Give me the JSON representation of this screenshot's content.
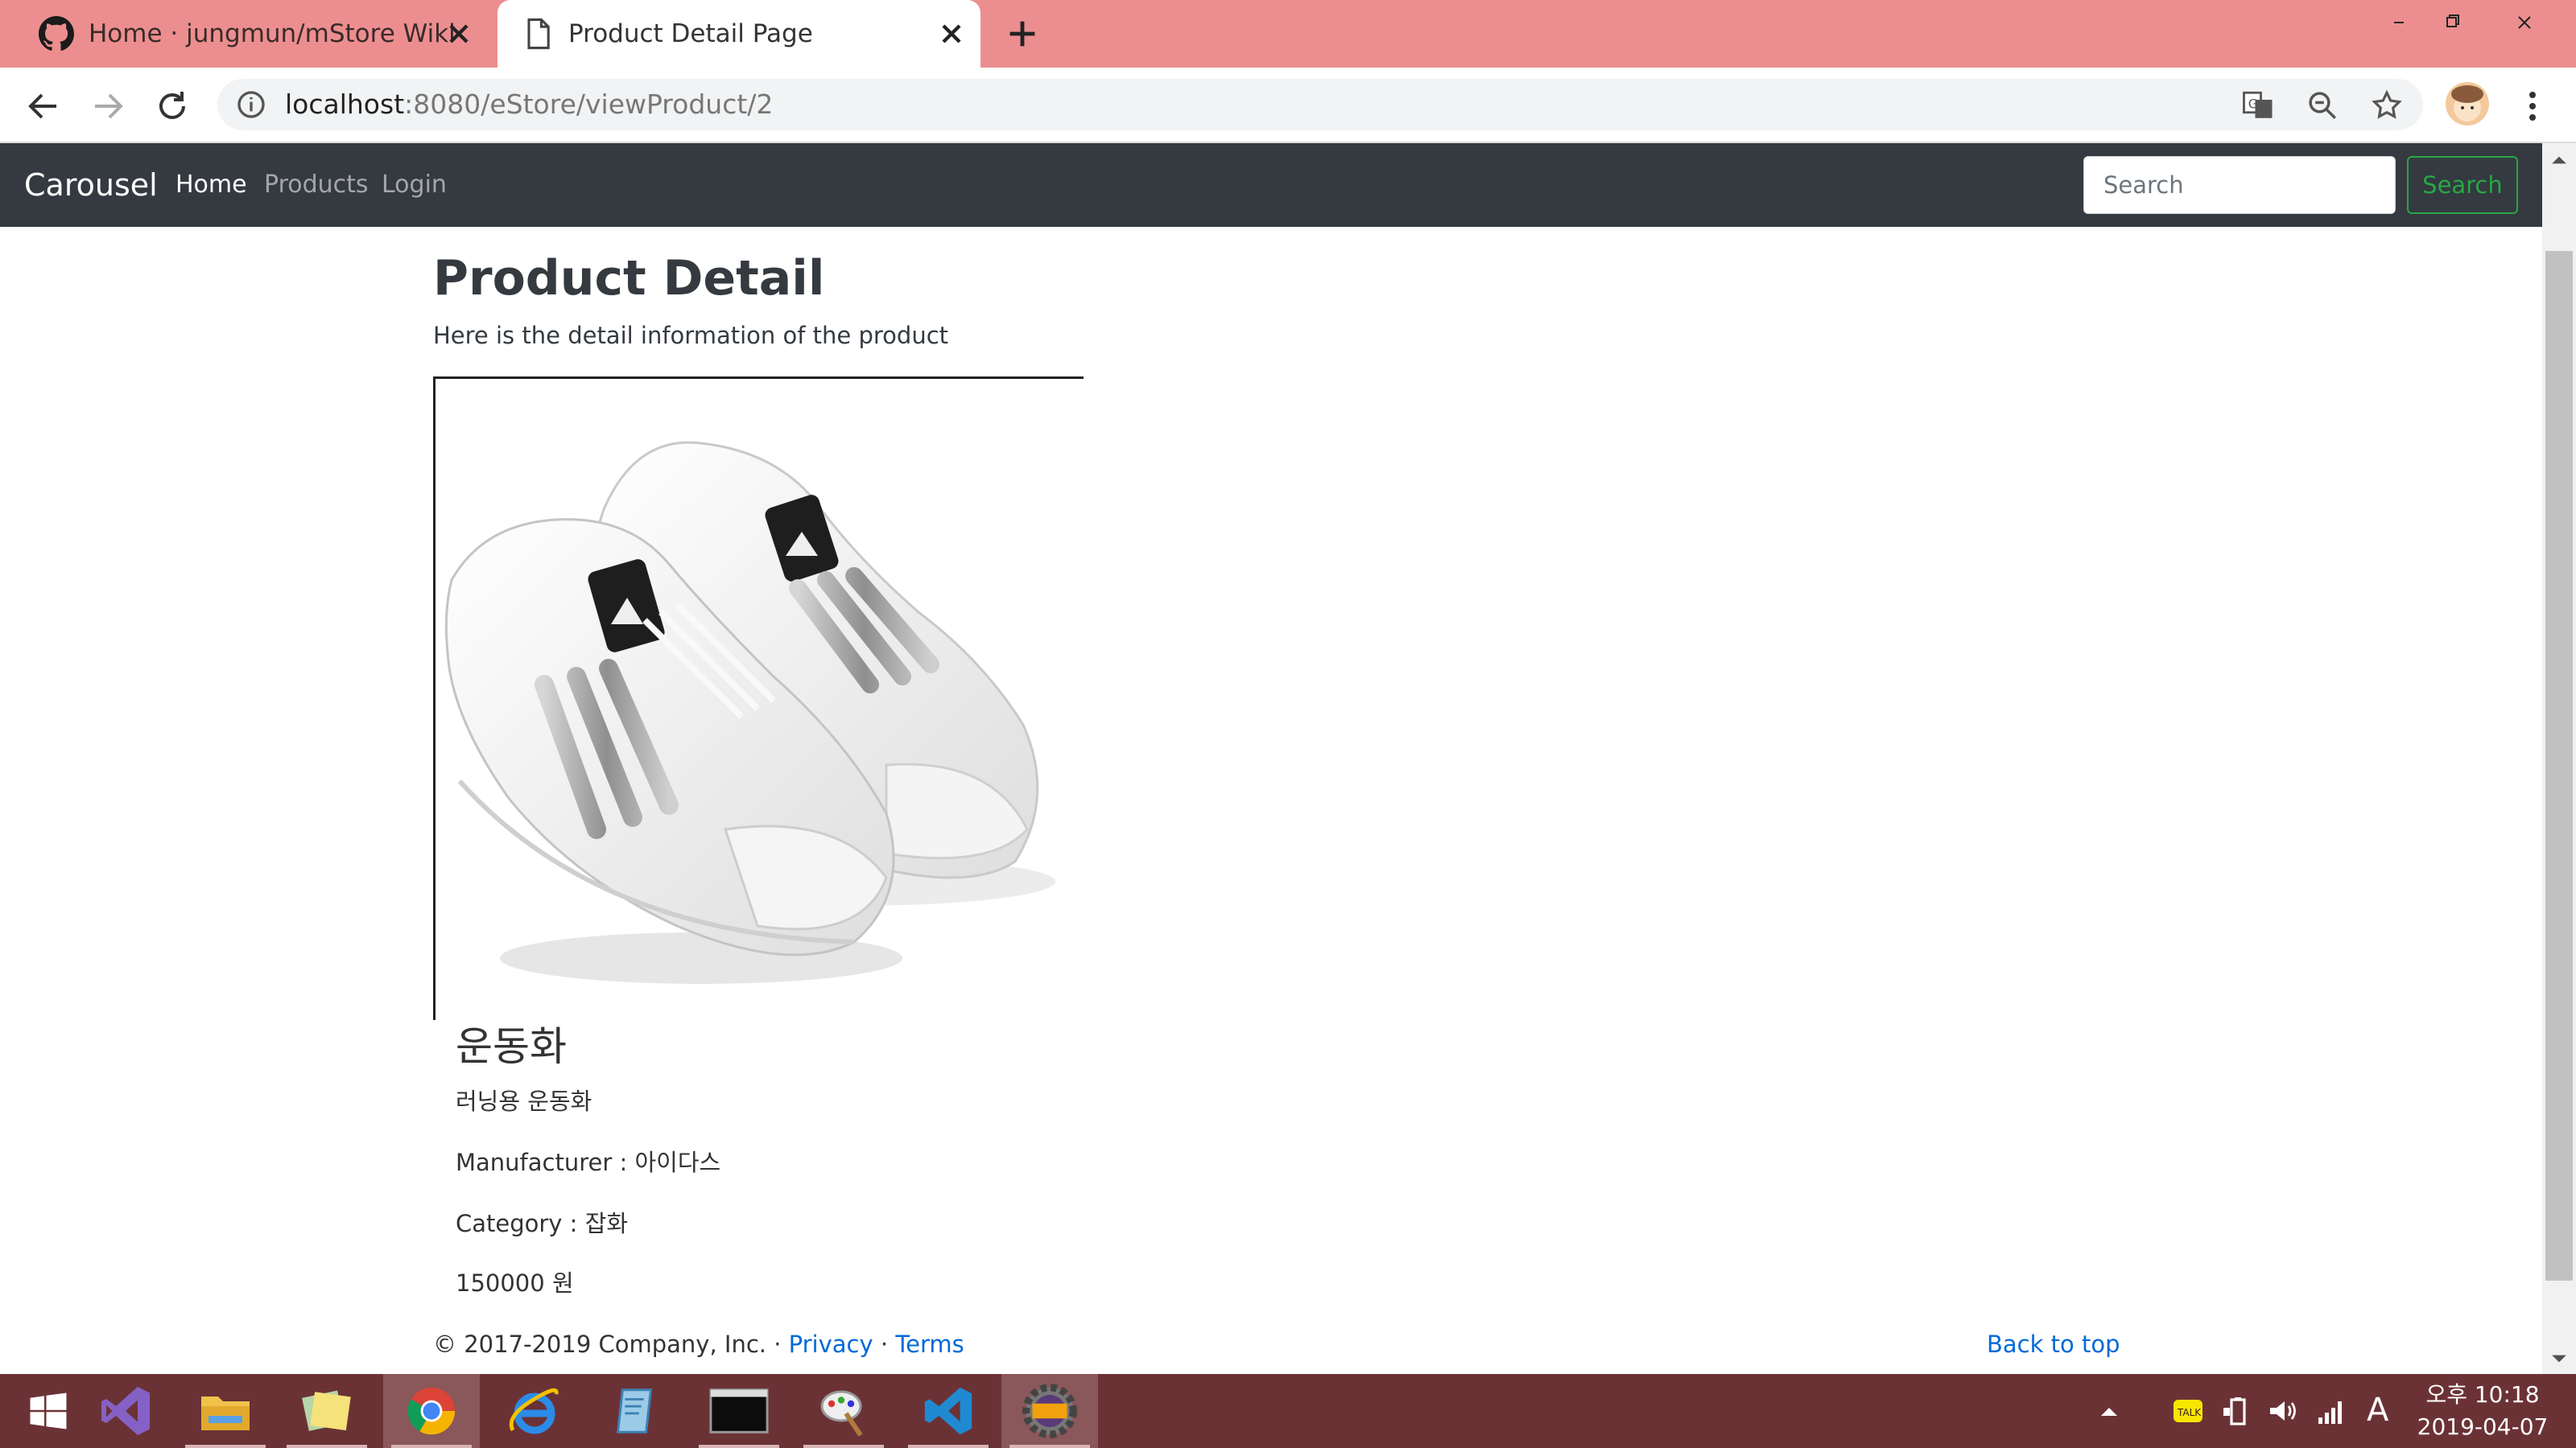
{
  "browser": {
    "tabs": [
      {
        "title": "Home · jungmun/mStore Wiki",
        "icon": "github-icon",
        "active": false
      },
      {
        "title": "Product Detail Page",
        "icon": "page-icon",
        "active": true
      }
    ],
    "url_host": "localhost",
    "url_path": ":8080/eStore/viewProduct/2"
  },
  "navbar": {
    "brand": "Carousel",
    "links": [
      {
        "label": "Home",
        "active": true
      },
      {
        "label": "Products",
        "active": false
      },
      {
        "label": "Login",
        "active": false
      }
    ],
    "search_placeholder": "Search",
    "search_button": "Search"
  },
  "page": {
    "title": "Product Detail",
    "subtitle": "Here is the detail information of the product"
  },
  "product": {
    "name": "운동화",
    "description": "러닝용 운동화",
    "manufacturer_label": "Manufacturer : ",
    "manufacturer": "아이다스",
    "category_label": "Category : ",
    "category": "잡화",
    "price": "150000",
    "currency": "원"
  },
  "footer": {
    "copyright": "© 2017-2019 Company, Inc. · ",
    "privacy": "Privacy",
    "separator": " · ",
    "terms": "Terms",
    "back_to_top": "Back to top"
  },
  "taskbar": {
    "apps": [
      "windows-start-icon",
      "visual-studio-icon",
      "file-explorer-icon",
      "sticky-notes-icon",
      "chrome-icon",
      "internet-explorer-icon",
      "notepad-icon",
      "terminal-icon",
      "paint-icon",
      "vscode-icon",
      "java-ee-ide-icon"
    ],
    "ime": "A",
    "time": "오후 10:18",
    "date": "2019-04-07"
  },
  "colors": {
    "tabstrip": "#ec8e8f",
    "navbar": "#343a40",
    "search_button": "#28a745",
    "link": "#0069d9",
    "taskbar": "#6b3236"
  }
}
